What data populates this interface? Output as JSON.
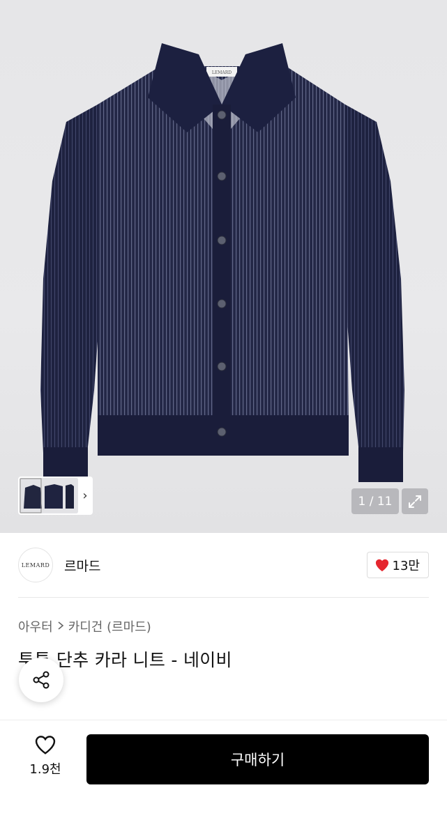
{
  "gallery": {
    "counter": "1 / 11",
    "thumb_arrow": "›",
    "garment_label": "LEMARD"
  },
  "brand": {
    "logo_text": "LEMARD",
    "name": "르마드",
    "likes": "13만"
  },
  "product": {
    "breadcrumb": [
      "아우터",
      "카디건 (르마드)"
    ],
    "title": "투톤 단추 카라 니트 - 네이비"
  },
  "bottom": {
    "wish_count": "1.9천",
    "buy_label": "구매하기"
  },
  "colors": {
    "navy": "#1f2342",
    "heart_red": "#e5262f",
    "buy_bg": "#000000"
  },
  "icons": {
    "share": "share-icon",
    "heart_outline": "heart-outline-icon",
    "heart_filled": "heart-filled-icon",
    "expand": "expand-icon",
    "chevron": "chevron-right-icon"
  }
}
